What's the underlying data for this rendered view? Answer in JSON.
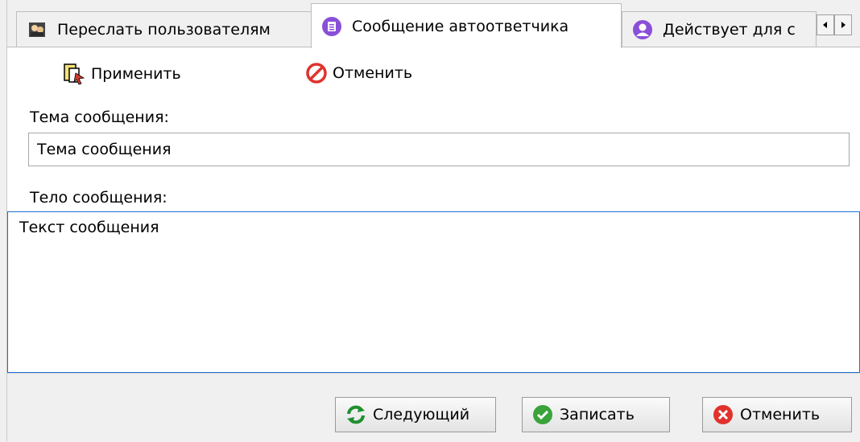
{
  "tabs": [
    {
      "label": "Переслать пользователям",
      "icon": "users-icon",
      "active": false
    },
    {
      "label": "Сообщение автоответчика",
      "icon": "message-list-icon",
      "active": true
    },
    {
      "label": "Действует для с",
      "icon": "user-icon",
      "active": false
    }
  ],
  "toolbar": {
    "apply_label": "Применить",
    "cancel_label": "Отменить"
  },
  "form": {
    "subject_label": "Тема сообщения:",
    "subject_value": "Тема сообщения",
    "body_label": "Тело сообщения:",
    "body_value": "Текст сообщения"
  },
  "buttons": {
    "next_label": "Следующий",
    "save_label": "Записать",
    "cancel_label": "Отменить"
  },
  "colors": {
    "accent": "#1c6fd6",
    "tab_icon_purple": "#8a4fd8",
    "cancel_red": "#e0322d",
    "save_green": "#3aa33a",
    "next_green": "#1f8f2f"
  }
}
